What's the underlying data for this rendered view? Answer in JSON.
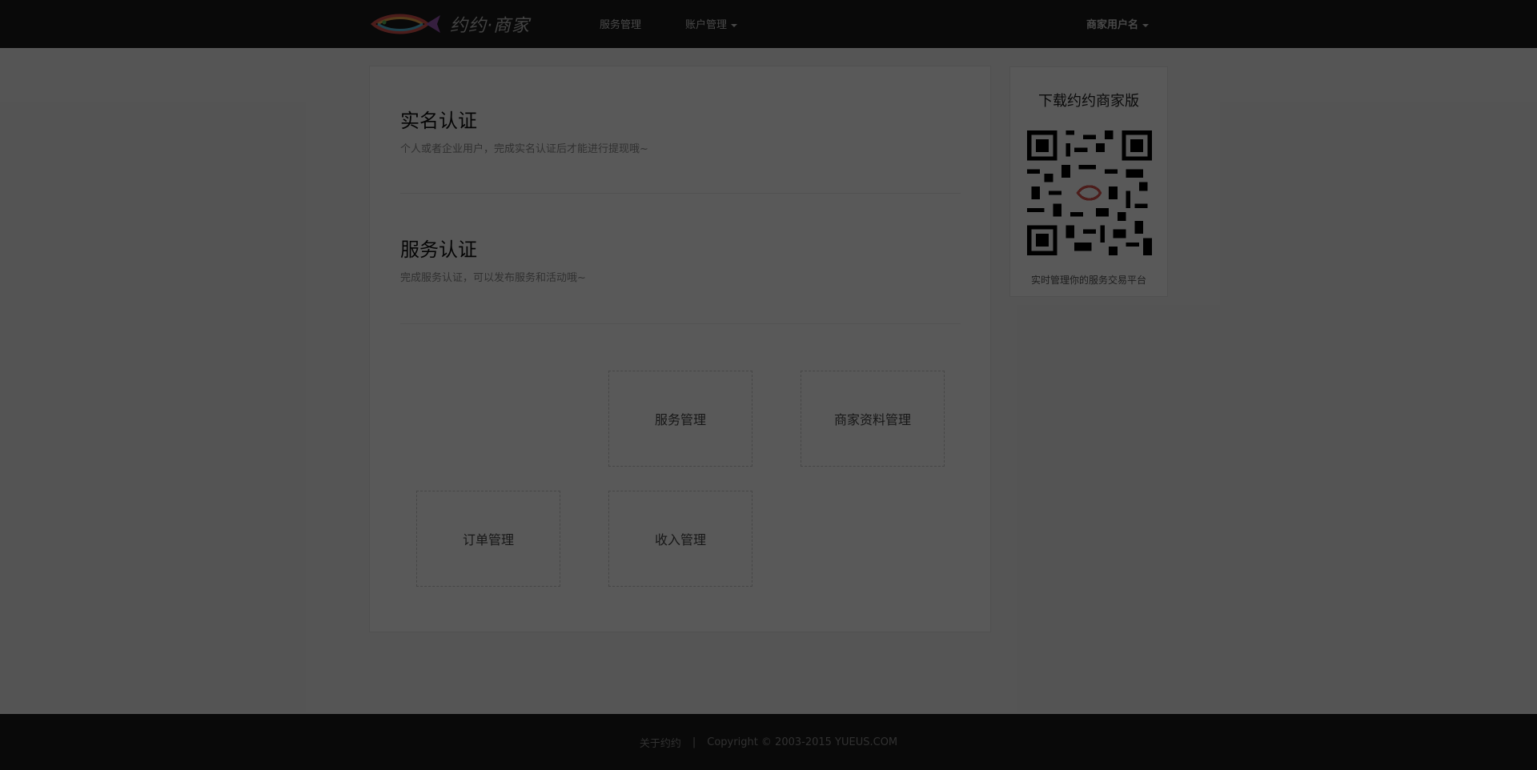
{
  "header": {
    "brand": "约约·商家",
    "nav": [
      {
        "label": "服务管理",
        "has_dropdown": false
      },
      {
        "label": "账户管理",
        "has_dropdown": true
      }
    ],
    "user_label": "商家用户名"
  },
  "main": {
    "sections": [
      {
        "title": "实名认证",
        "subtitle": "个人或者企业用户，完成实名认证后才能进行提现哦~"
      },
      {
        "title": "服务认证",
        "subtitle": "完成服务认证，可以发布服务和活动哦~"
      }
    ],
    "tiles": [
      "服务管理",
      "商家资料管理",
      "订单管理",
      "收入管理"
    ]
  },
  "sidebar": {
    "title": "下载约约商家版",
    "qr_icon": "qr-code-icon",
    "subtitle": "实时管理你的服务交易平台"
  },
  "footer": {
    "about": "关于约约",
    "separator": "|",
    "copyright": "Copyright © 2003-2015 YUEUS.COM"
  },
  "colors": {
    "header_bg": "#1a1a1a",
    "page_bg": "#f2f2f2",
    "overlay": "rgba(0,0,0,0.65)"
  }
}
